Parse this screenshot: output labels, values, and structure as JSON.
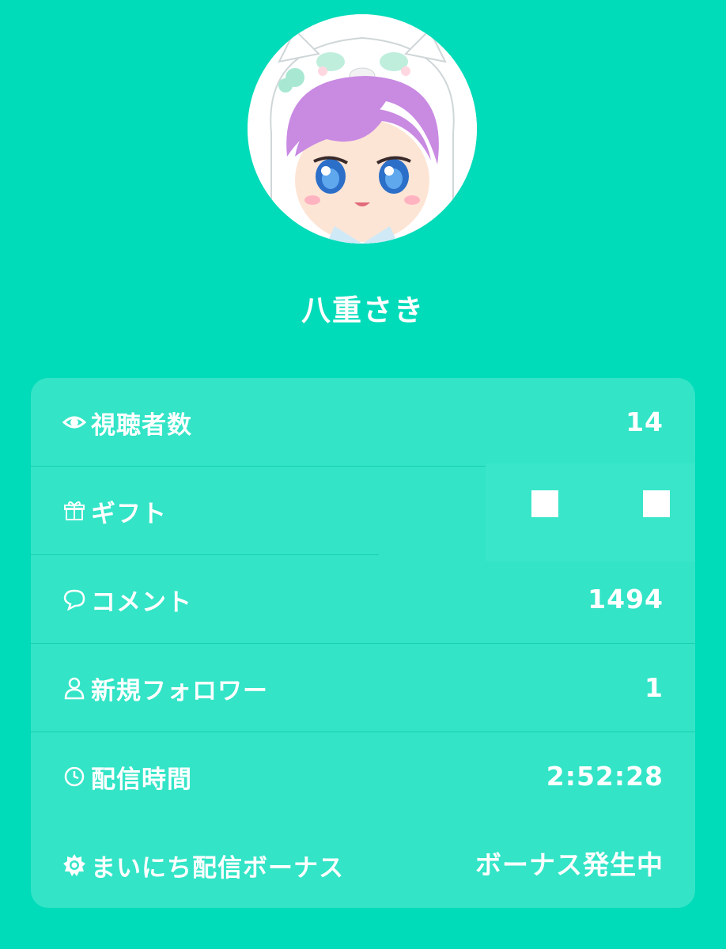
{
  "profile": {
    "username": "八重さき",
    "avatar_icon": "chibi-avatar-icon"
  },
  "colors": {
    "background": "#00dbb9",
    "card": "#33e4c7",
    "text": "#ffffff"
  },
  "stats": [
    {
      "icon": "eye-icon",
      "label": "視聴者数",
      "value": "14"
    },
    {
      "icon": "gift-icon",
      "label": "ギフト",
      "value": ""
    },
    {
      "icon": "comment-icon",
      "label": "コメント",
      "value": "1494"
    },
    {
      "icon": "person-icon",
      "label": "新規フォロワー",
      "value": "1"
    },
    {
      "icon": "clock-icon",
      "label": "配信時間",
      "value": "2:52:28"
    },
    {
      "icon": "sun-icon",
      "label": "まいにち配信ボーナス",
      "value": "ボーナス発生中"
    }
  ]
}
